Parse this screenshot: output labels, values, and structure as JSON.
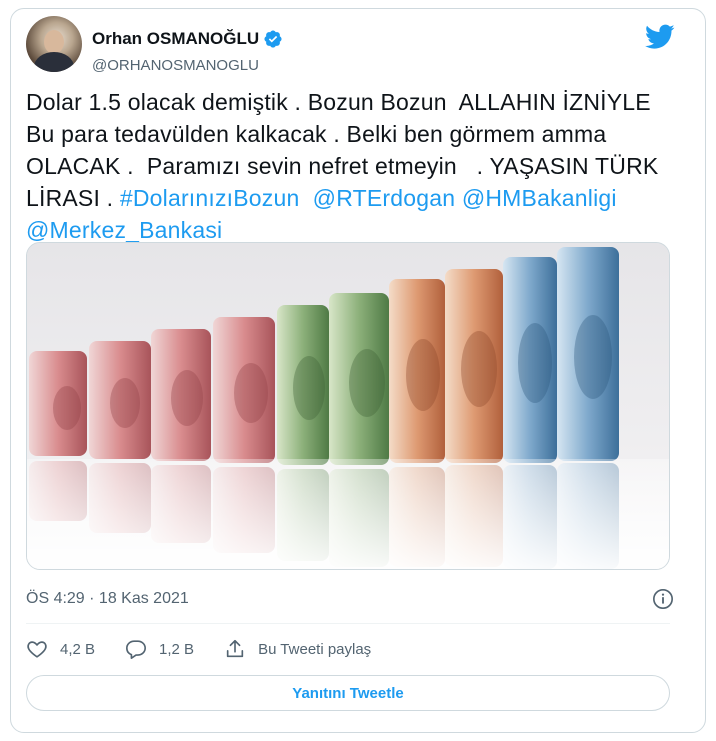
{
  "author": {
    "display_name": "Orhan OSMANOĞLU",
    "handle": "@ORHANOSMANOGLU",
    "verified": true
  },
  "tweet": {
    "text_line1": "Dolar 1.5 olacak demiştik . Bozun Bozun  ALLAHIN İZNİYLE",
    "text_line2": "Bu para tedavülden kalkacak . Belki ben görmem amma",
    "text_line3": "OLACAK .  Paramızı sevin nefret etmeyin   . YAŞASIN TÜRK",
    "text_line4_prefix": "LİRASI . ",
    "hashtag": "#DolarınızıBozun",
    "mention1": "@RTErdogan",
    "mention2": "@HMBakanligi",
    "mention3": "@Merkez_Bankasi",
    "timestamp": "ÖS 4:29 · 18 Kas 2021"
  },
  "stats": {
    "likes": "4,2 B",
    "replies": "1,2 B",
    "share_label": "Bu Tweeti paylaş"
  },
  "reply_button_label": "Yanıtını Tweetle",
  "colors": {
    "accent": "#1d9bf0",
    "text": "#0f1419",
    "muted": "#536471",
    "border": "#cfd9de"
  },
  "icons": {
    "brand": "twitter-bird-icon",
    "verified": "verified-badge-icon",
    "info": "info-icon",
    "like": "heart-icon",
    "reply": "comment-icon",
    "share": "share-icon"
  }
}
